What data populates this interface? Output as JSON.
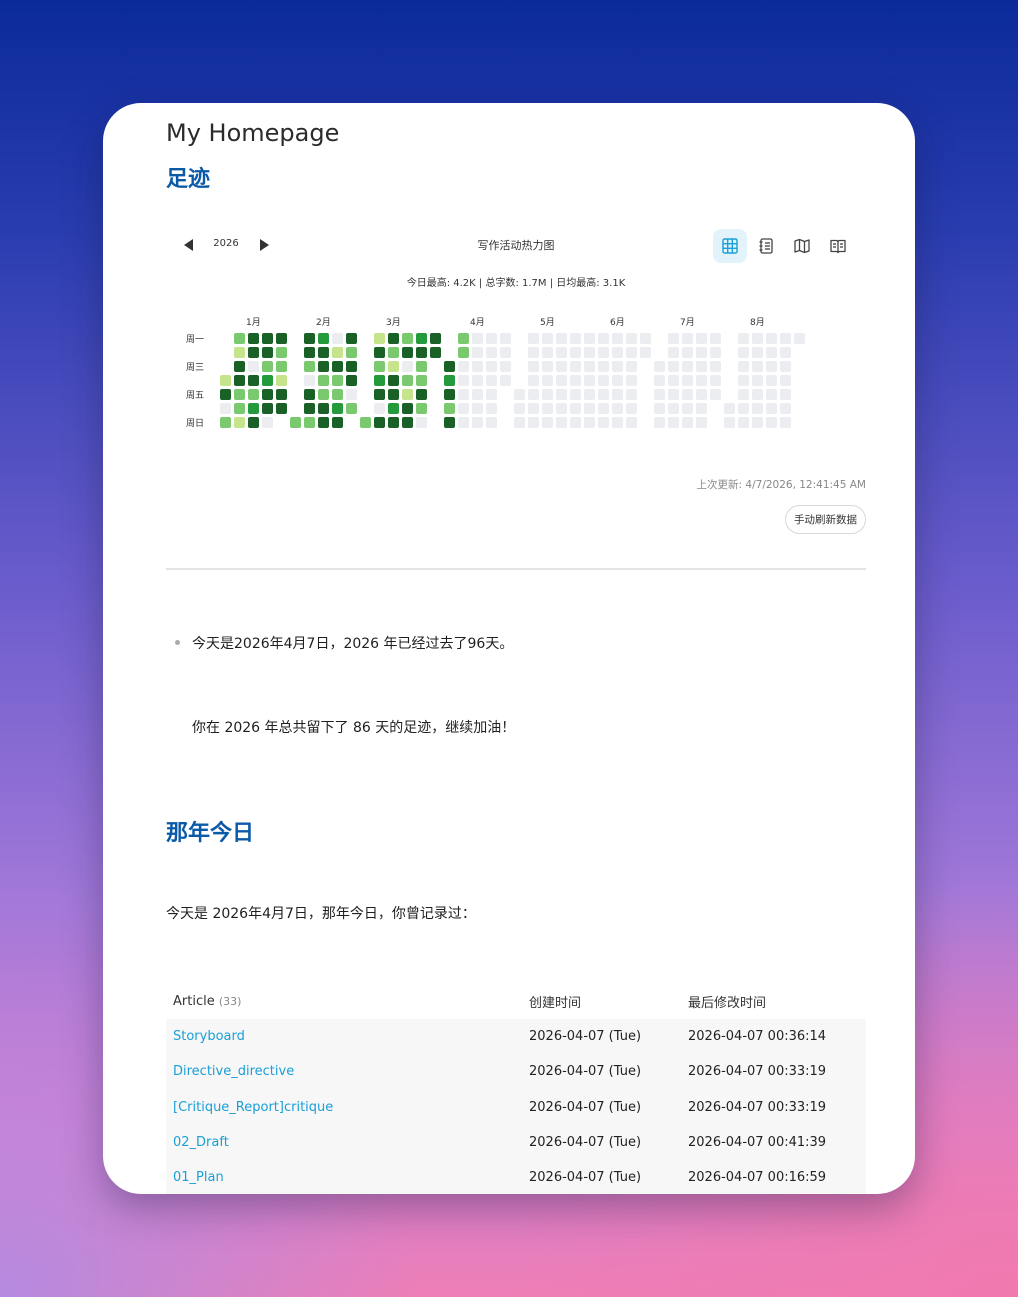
{
  "page": {
    "title": "My Homepage"
  },
  "footprint": {
    "heading": "足迹",
    "heatmap": {
      "year": "2026",
      "title": "写作活动热力图",
      "stats": "今日最高: 4.2K | 总字数: 1.7M | 日均最高: 3.1K",
      "months": [
        "1月",
        "2月",
        "3月",
        "4月",
        "5月",
        "6月",
        "7月",
        "8月"
      ],
      "day_labels": [
        "周一",
        "周三",
        "周五",
        "周日"
      ],
      "views": [
        "grid-icon",
        "list-icon",
        "map-icon",
        "book-icon"
      ],
      "colors": {
        "empty": "#ebedf0",
        "level1": "#c6e48b",
        "level2": "#7bc96f",
        "level3": "#239a3b",
        "level4": "#196127"
      },
      "active_until": "2026-04-07"
    },
    "last_update": "上次更新: 4/7/2026, 12:41:45 AM",
    "refresh_label": "手动刷新数据"
  },
  "summary": {
    "line1": "今天是2026年4月7日，2026 年已经过去了96天。",
    "line2": "你在 2026 年总共留下了 86 天的足迹，继续加油！"
  },
  "on_this_day": {
    "heading": "那年今日",
    "intro": "今天是 2026年4月7日，那年今日，你曾记录过：",
    "table": {
      "col_article": "Article",
      "count": "(33)",
      "col_created": "创建时间",
      "col_modified": "最后修改时间",
      "rows": [
        {
          "article": "Storyboard",
          "created": "2026-04-07 (Tue)",
          "modified": "2026-04-07 00:36:14"
        },
        {
          "article": "Directive_directive",
          "created": "2026-04-07 (Tue)",
          "modified": "2026-04-07 00:33:19"
        },
        {
          "article": "[Critique_Report]critique",
          "created": "2026-04-07 (Tue)",
          "modified": "2026-04-07 00:33:19"
        },
        {
          "article": "02_Draft",
          "created": "2026-04-07 (Tue)",
          "modified": "2026-04-07 00:41:39"
        },
        {
          "article": "01_Plan",
          "created": "2026-04-07 (Tue)",
          "modified": "2026-04-07 00:16:59"
        }
      ]
    }
  }
}
